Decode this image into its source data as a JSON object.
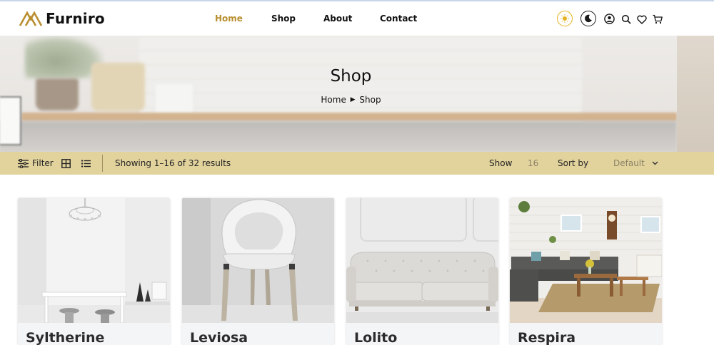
{
  "brand": {
    "name": "Furniro",
    "accent": "#b88e2f"
  },
  "nav": {
    "items": [
      {
        "label": "Home",
        "active": true
      },
      {
        "label": "Shop",
        "active": false
      },
      {
        "label": "About",
        "active": false
      },
      {
        "label": "Contact",
        "active": false
      }
    ]
  },
  "header_icons": [
    "sun-icon",
    "moon-icon",
    "account-icon",
    "search-icon",
    "heart-icon",
    "cart-icon"
  ],
  "hero": {
    "title": "Shop",
    "breadcrumb": {
      "home": "Home",
      "separator": "▶",
      "current": "Shop"
    }
  },
  "filterbar": {
    "filter_label": "Filter",
    "results_text": "Showing 1–16 of 32 results",
    "show_label": "Show",
    "show_value": "16",
    "sort_label": "Sort by",
    "sort_value": "Default",
    "bar_color": "#e2d39d"
  },
  "products": [
    {
      "name": "Syltherine"
    },
    {
      "name": "Leviosa"
    },
    {
      "name": "Lolito"
    },
    {
      "name": "Respira"
    }
  ]
}
